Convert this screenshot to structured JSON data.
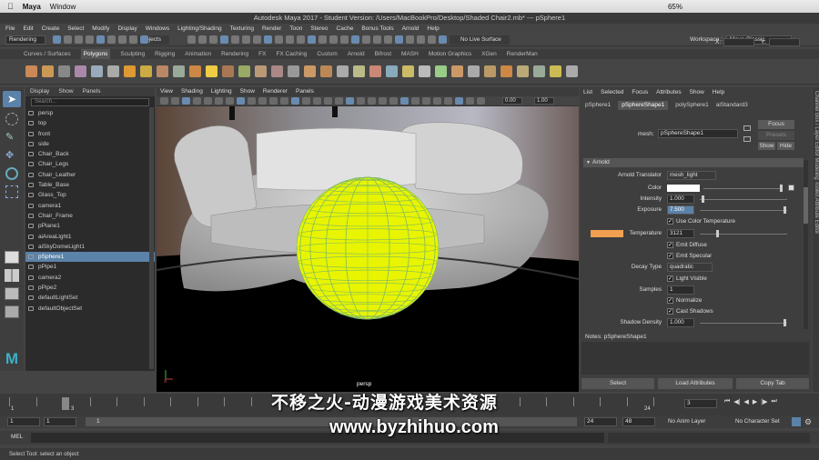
{
  "mac": {
    "app": "Maya",
    "window_menu": "Window",
    "battery": "65%"
  },
  "title": "Autodesk Maya 2017 - Student Version: /Users/MacBookPro/Desktop/Shaded Chair2.mb*   ---   pSphere1",
  "menubar": [
    "File",
    "Edit",
    "Create",
    "Select",
    "Modify",
    "Display",
    "Windows",
    "Lighting/Shading",
    "Texturing",
    "Render",
    "Toon",
    "Stereo",
    "Cache",
    "Bonus Tools",
    "Arnold",
    "Help"
  ],
  "status": {
    "mode": "Rendering",
    "objects": "Objects",
    "live_surface": "No Live Surface",
    "workspace_label": "Workspace :",
    "workspace": "Maya Classic",
    "x": "X:",
    "y": "Y:"
  },
  "shelf_tabs": [
    "Curves / Surfaces",
    "Polygons",
    "Sculpting",
    "Rigging",
    "Animation",
    "Rendering",
    "FX",
    "FX Caching",
    "Custom",
    "Arnold",
    "Bifrost",
    "MASH",
    "Motion Graphics",
    "XGen",
    "RenderMan"
  ],
  "shelf_active": "Polygons",
  "outliner": {
    "menu": [
      "Display",
      "Show",
      "Panels"
    ],
    "search": "Search...",
    "items": [
      "persp",
      "top",
      "front",
      "side",
      "Chair_Back",
      "Chair_Legs",
      "Chair_Leather",
      "Table_Base",
      "Glass_Top",
      "camera1",
      "Chair_Frame",
      "pPlane1",
      "aiAreaLight1",
      "aiSkyDomeLight1",
      "pSphere1",
      "pPipe1",
      "camera2",
      "pPipe2",
      "defaultLightSet",
      "defaultObjectSet"
    ],
    "selected": "pSphere1"
  },
  "viewport": {
    "menu": [
      "View",
      "Shading",
      "Lighting",
      "Show",
      "Renderer",
      "Panels"
    ],
    "field1": "0.00",
    "field2": "1.00",
    "camera": "persp"
  },
  "attr": {
    "menu": [
      "List",
      "Selected",
      "Focus",
      "Attributes",
      "Show",
      "Help"
    ],
    "tabs": [
      "pSphere1",
      "pSphereShape1",
      "polySphere1",
      "aiStandard3"
    ],
    "active_tab": "pSphereShape1",
    "mesh_label": "mesh:",
    "mesh_value": "pSphereShape1",
    "focus": "Focus",
    "presets": "Presets",
    "show": "Show",
    "hide": "Hide",
    "section": "Arnold",
    "translator_label": "Arnold Translator",
    "translator": "mesh_light",
    "color_label": "Color",
    "intensity_label": "Intensity",
    "intensity": "1.000",
    "exposure_label": "Exposure",
    "exposure": "7.500",
    "use_color_temp": "Use Color Temperature",
    "temperature_label": "Temperature",
    "temperature": "3121",
    "emit_diffuse": "Emit Diffuse",
    "emit_specular": "Emit Specular",
    "decay_label": "Decay Type",
    "decay": "quadratic",
    "light_visible": "Light Visible",
    "samples_label": "Samples",
    "samples": "1",
    "normalize": "Normalize",
    "cast_shadows": "Cast Shadows",
    "shadow_density_label": "Shadow Density",
    "shadow_density": "1.000",
    "notes": "Notes:  pSphereShape1",
    "btn_select": "Select",
    "btn_load": "Load Attributes",
    "btn_copy": "Copy Tab",
    "side_tabs": "Channel Box / Layer Editor   Modeling Toolkit   Attribute Editor"
  },
  "timeline": {
    "ticks": [
      "1",
      "",
      "3",
      "",
      "",
      "",
      "",
      "",
      "",
      "",
      "",
      "",
      "",
      "",
      "",
      "",
      "",
      "",
      "",
      "",
      "",
      "",
      "",
      "",
      "",
      ""
    ],
    "current": "3",
    "end_marker": "24"
  },
  "range": {
    "start": "1",
    "start2": "1",
    "inner_start": "1",
    "end": "24",
    "end2": "48",
    "anim_layer": "No Anim Layer",
    "char_set": "No Character Set"
  },
  "mel": "MEL",
  "help": "Select Tool: select an object",
  "watermark": {
    "cn": "不移之火-动漫游戏美术资源",
    "url": "www.byzhihuo.com"
  },
  "colors": {
    "temperature_swatch": "#f0a050",
    "sphere": "#e8f400",
    "sphere_wire": "#7ab86a",
    "select": "#5b82a8"
  }
}
